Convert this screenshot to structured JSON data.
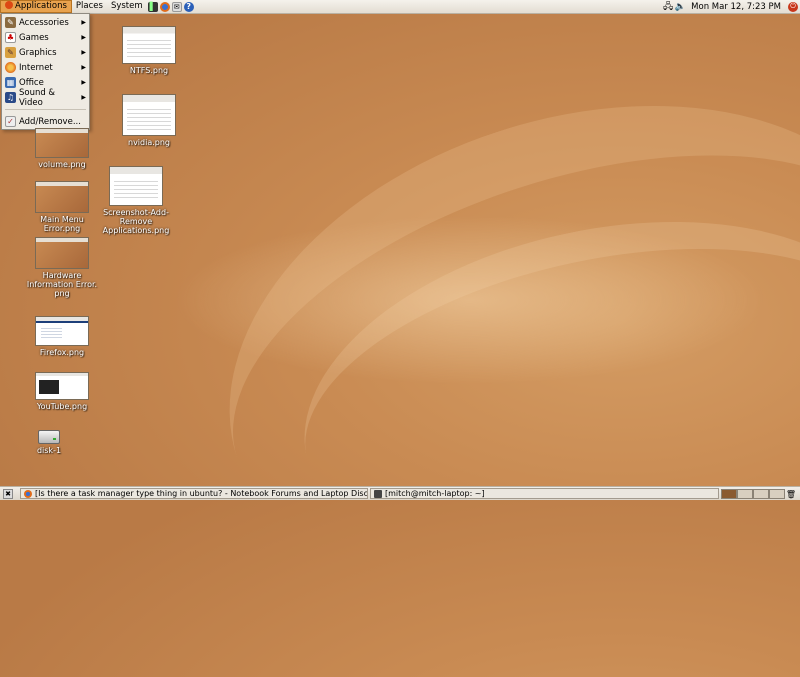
{
  "top_panel": {
    "menus": [
      "Applications",
      "Places",
      "System"
    ],
    "clock": "Mon Mar 12,  7:23 PM"
  },
  "app_menu": {
    "items": [
      {
        "label": "Accessories",
        "icon": "accessories-icon",
        "submenu": true
      },
      {
        "label": "Games",
        "icon": "games-icon",
        "submenu": true
      },
      {
        "label": "Graphics",
        "icon": "graphics-icon",
        "submenu": true
      },
      {
        "label": "Internet",
        "icon": "internet-icon",
        "submenu": true
      },
      {
        "label": "Office",
        "icon": "office-icon",
        "submenu": true
      },
      {
        "label": "Sound & Video",
        "icon": "sound-video-icon",
        "submenu": true
      }
    ],
    "add_remove": "Add/Remove..."
  },
  "desktop_icons": [
    {
      "label": "NTFS.png"
    },
    {
      "label": "nvidia.png"
    },
    {
      "label": "volume.png"
    },
    {
      "label": "Screenshot-Add-\nRemove\nApplications.png"
    },
    {
      "label": "Main Menu Error.png"
    },
    {
      "label": "Hardware\nInformation Error.\npng"
    },
    {
      "label": "Firefox.png"
    },
    {
      "label": "YouTube.png"
    },
    {
      "label": "disk-1"
    }
  ],
  "taskbar": {
    "tasks": [
      "[Is there a task manager type thing in ubuntu? - Notebook Forums and Laptop Discussion -...",
      "[mitch@mitch-laptop: ~]"
    ]
  },
  "colors": {
    "accent": "#e8a24e",
    "desktop": "#c98b53",
    "ubuntu_orange": "#dd4814"
  }
}
